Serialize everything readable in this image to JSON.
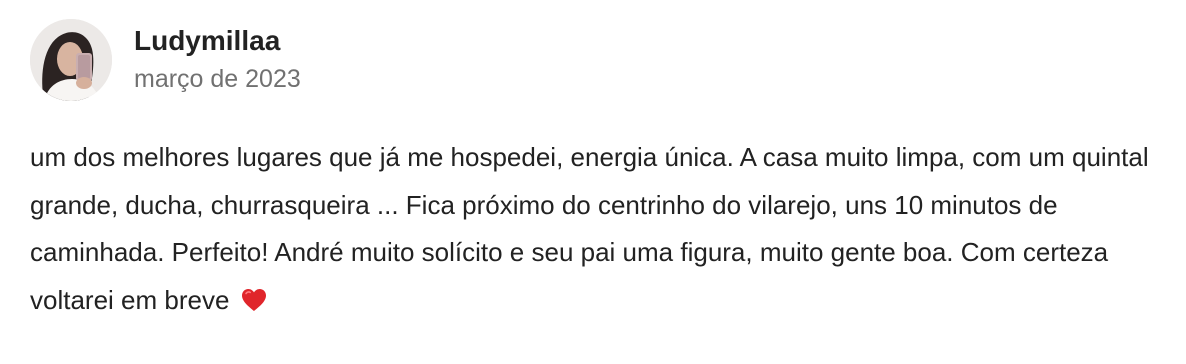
{
  "review": {
    "author_name": "Ludymillaa",
    "date": "março de 2023",
    "text": "um dos melhores lugares que já me hospedei, energia única. A casa muito limpa, com um quintal grande, ducha, churrasqueira ... Fica próximo do centrinho do vilarejo, uns 10 minutos de caminhada. Perfeito! André muito solícito e seu pai uma figura, muito gente boa. Com certeza voltarei em breve",
    "emoji": "heart-emoji"
  },
  "colors": {
    "text_primary": "#222222",
    "text_secondary": "#717171",
    "heart": "#e0252b"
  }
}
